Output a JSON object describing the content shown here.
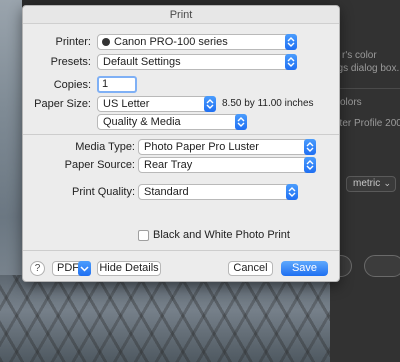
{
  "background": {
    "panel_texts": [
      "r's color",
      "ngs dialog box.",
      "olors",
      "nter Profile 2005"
    ],
    "panel_select": "metric",
    "panel_select_chevron": "chevron-down-icon"
  },
  "dialog": {
    "title": "Print",
    "printer": {
      "label": "Printer:",
      "value": "Canon PRO-100 series",
      "icon": "printer-status-icon"
    },
    "presets": {
      "label": "Presets:",
      "value": "Default Settings"
    },
    "copies": {
      "label": "Copies:",
      "value": "1"
    },
    "paper_size": {
      "label": "Paper Size:",
      "value": "US Letter",
      "dimensions": "8.50 by 11.00 inches"
    },
    "section": {
      "value": "Quality & Media"
    },
    "media_type": {
      "label": "Media Type:",
      "value": "Photo Paper Pro Luster"
    },
    "paper_source": {
      "label": "Paper Source:",
      "value": "Rear Tray"
    },
    "print_quality": {
      "label": "Print Quality:",
      "value": "Standard"
    },
    "bw_photo": {
      "label": "Black and White Photo Print",
      "checked": false
    },
    "footer": {
      "help": "?",
      "pdf": "PDF",
      "hide_details": "Hide Details",
      "cancel": "Cancel",
      "save": "Save"
    }
  },
  "colors": {
    "accent": "#1f6ff2",
    "dialog_bg": "#ececec"
  }
}
